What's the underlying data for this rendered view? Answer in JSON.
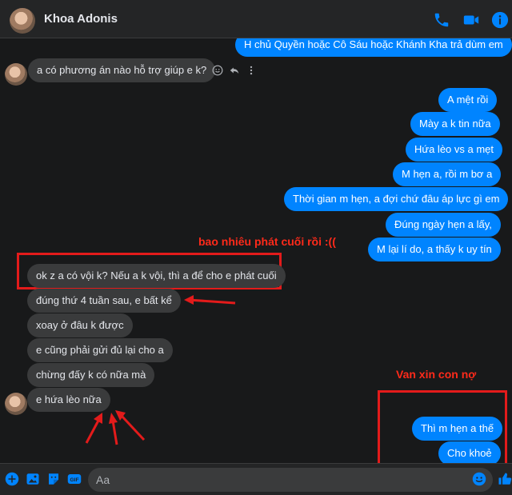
{
  "header": {
    "contact_name": "Khoa Adonis"
  },
  "messages": {
    "top_partial": "H chủ Quyền hoặc Cô Sáu hoặc Khánh Kha trả dùm em",
    "m1": "a có phương án nào hỗ trợ giúp e k?",
    "m2": "A mệt rồi",
    "m3": "Mày a k tin nữa",
    "m4": "Hứa lèo vs a mẹt",
    "m5": "M hẹn a, rồi m bơ a",
    "m6": "Thời gian m hẹn, a đợi chứ đâu áp lực gì em",
    "m7": "Đúng ngày hẹn a lấy,",
    "m8": "M lại lí do, a thấy k uy tín",
    "m9": "ok z a có vội k? Nếu a k vội, thì a để cho e phát cuối",
    "m10": "đúng thứ 4 tuần sau, e bất kể",
    "m11": "xoay ở đâu k được",
    "m12": "e cũng phải gửi đủ lại cho a",
    "m13": "chừng đấy k có nữa mà",
    "m14": "e hứa lèo nữa",
    "m15": "Thì m hẹn a thế",
    "m16": "Cho khoẻ"
  },
  "annotations": {
    "note1": "bao nhiêu phát cuối rồi :((",
    "note2": "Van xin con nợ"
  },
  "composer": {
    "placeholder": "Aa"
  },
  "colors": {
    "accent": "#0084ff",
    "incoming_bubble": "#3a3b3c",
    "annotation_red": "#e31b1b"
  }
}
